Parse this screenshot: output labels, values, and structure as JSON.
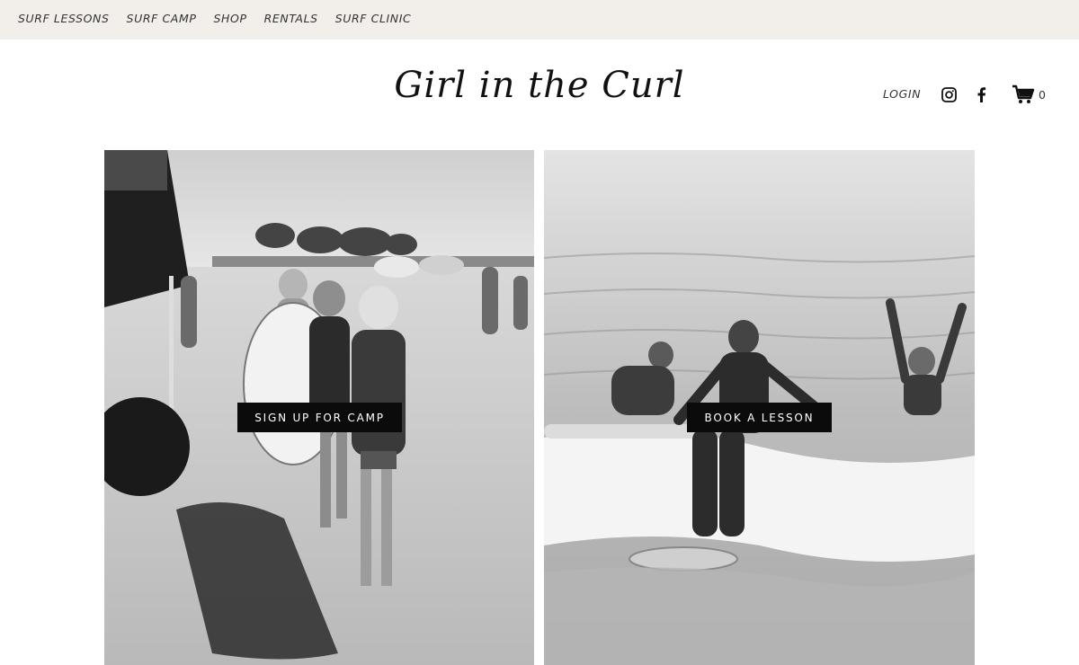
{
  "topnav": {
    "items": [
      {
        "label": "SURF LESSONS"
      },
      {
        "label": "SURF CAMP"
      },
      {
        "label": "SHOP"
      },
      {
        "label": "RENTALS"
      },
      {
        "label": "SURF CLINIC"
      }
    ]
  },
  "header": {
    "logo_text": "Girl in the Curl",
    "login_label": "LOGIN",
    "cart_count": "0",
    "icons": [
      "instagram-icon",
      "facebook-icon",
      "cart-icon"
    ]
  },
  "panels": [
    {
      "button_label": "SIGN UP FOR CAMP",
      "image": "kids-with-surfboards-on-beach-photo"
    },
    {
      "button_label": "BOOK A LESSON",
      "image": "girl-surfing-wave-photo"
    }
  ],
  "colors": {
    "topbar_bg": "#f2eee9",
    "cta_bg": "#0b0b0b",
    "cta_text": "#ffffff"
  }
}
